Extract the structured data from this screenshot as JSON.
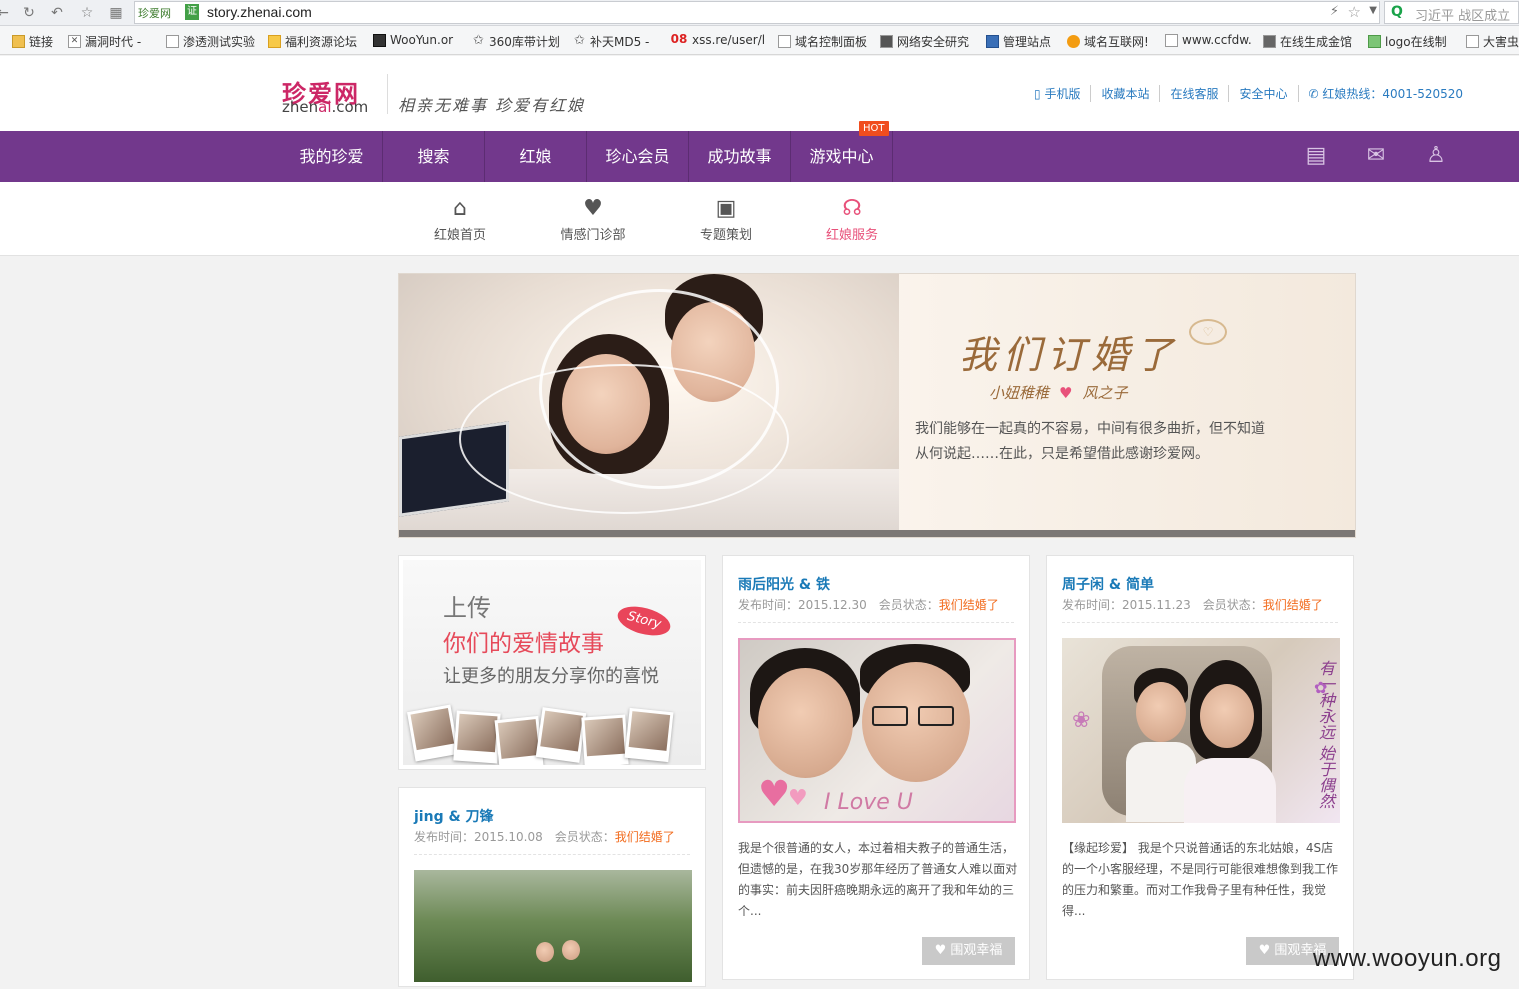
{
  "browser": {
    "url": "story.zhenai.com",
    "site_tag": "珍爱网",
    "ev_tag": "证",
    "search_placeholder": "习近平 战区成立",
    "bookmarks": [
      {
        "label": "链接"
      },
      {
        "label": "漏洞时代 -"
      },
      {
        "label": "渗透测试实验"
      },
      {
        "label": "福利资源论坛"
      },
      {
        "label": "WooYun.or"
      },
      {
        "label": "360库带计划"
      },
      {
        "label": "补天MD5 -"
      },
      {
        "label": "xss.re/user/l"
      },
      {
        "label": "域名控制面板"
      },
      {
        "label": "网络安全研究"
      },
      {
        "label": "管理站点"
      },
      {
        "label": "域名互联网!"
      },
      {
        "label": "www.ccfdw."
      },
      {
        "label": "在线生成金馆"
      },
      {
        "label": "logo在线制"
      },
      {
        "label": "大害虫"
      }
    ]
  },
  "header": {
    "logo_cn": "珍爱网",
    "logo_en_a": "zhen",
    "logo_en_b": "ai",
    "logo_en_c": ".com",
    "slogan": "相亲无难事 珍爱有红娘",
    "links": [
      "手机版",
      "收藏本站",
      "在线客服",
      "安全中心",
      "红娘热线：4001-520520"
    ]
  },
  "nav": {
    "items": [
      "我的珍爱",
      "搜索",
      "红娘",
      "珍心会员",
      "成功故事",
      "游戏中心"
    ],
    "hot_badge": "HOT"
  },
  "subnav": {
    "items": [
      {
        "label": "红娘首页",
        "icon": "home-icon"
      },
      {
        "label": "情感门诊部",
        "icon": "heart-plus-icon"
      },
      {
        "label": "专题策划",
        "icon": "topic-icon"
      },
      {
        "label": "红娘服务",
        "icon": "headset-icon"
      }
    ],
    "active": "红娘服务"
  },
  "banner": {
    "title": "我们订婚了",
    "name_a": "小妞稚稚",
    "name_b": "风之子",
    "desc": "我们能够在一起真的不容易，中间有很多曲折，但不知道从何说起……在此，只是希望借此感谢珍爱网。"
  },
  "upload": {
    "line1": "上传",
    "line2": "你们的爱情故事",
    "line3": "让更多的朋友分享你的喜悦",
    "badge": "Story"
  },
  "stories": {
    "jing": {
      "title": "jing & 刀锋",
      "date_label": "发布时间：",
      "date": "2015.10.08",
      "status_label": "会员状态：",
      "status": "我们结婚了"
    },
    "yu": {
      "title": "雨后阳光 & 铁",
      "date_label": "发布时间：",
      "date": "2015.12.30",
      "status_label": "会员状态：",
      "status": "我们结婚了",
      "text": "我是个很普通的女人，本过着相夫教子的普通生活，但遗憾的是，在我30岁那年经历了普通女人难以面对的事实：前夫因肝癌晚期永远的离开了我和年幼的三个...",
      "photo_caption": "I Love U",
      "button": "围观幸福"
    },
    "zhou": {
      "title": "周子闲 & 简单",
      "date_label": "发布时间：",
      "date": "2015.11.23",
      "status_label": "会员状态：",
      "status": "我们结婚了",
      "text": "【缘起珍爱】 我是个只说普通话的东北姑娘，4S店的一个小客服经理，不是同行可能很难想像到我工作的压力和繁重。而对工作我骨子里有种任性，我觉得...",
      "photo_poem": "有一种永远 始于偶然",
      "button": "围观幸福"
    }
  },
  "watermark": "www.wooyun.org",
  "colors": {
    "nav_purple": "#72388c",
    "brand_pink": "#cc2766",
    "link_blue": "#1a7ab7",
    "status_orange": "#f26b1d"
  }
}
